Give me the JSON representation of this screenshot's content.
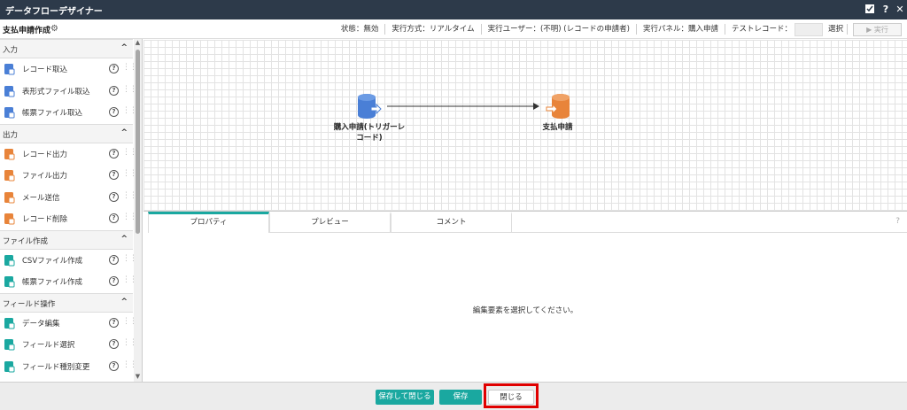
{
  "window": {
    "title": "データフローデザイナー",
    "controls": [
      "minimize-icon",
      "help-icon",
      "close-icon"
    ]
  },
  "header": {
    "flow_name": "支払申請作成",
    "status": "状態：無効",
    "exec_mode": "実行方式：リアルタイム",
    "exec_user": "実行ユーザー：(不明) (レコードの申請者)",
    "exec_panel": "実行パネル：購入申請",
    "test_record_label": "テストレコード：",
    "select_label": "選択",
    "run_label": "▶ 実行"
  },
  "sidebar": {
    "sections": [
      {
        "title": "入力",
        "items": [
          {
            "label": "レコード取込",
            "icon": "record-import-icon",
            "color": "#4a7fd6"
          },
          {
            "label": "表形式ファイル取込",
            "icon": "table-file-import-icon",
            "color": "#4a7fd6"
          },
          {
            "label": "帳票ファイル取込",
            "icon": "form-file-import-icon",
            "color": "#4a7fd6"
          }
        ]
      },
      {
        "title": "出力",
        "items": [
          {
            "label": "レコード出力",
            "icon": "record-output-icon",
            "color": "#e8843a"
          },
          {
            "label": "ファイル出力",
            "icon": "file-output-icon",
            "color": "#e8843a"
          },
          {
            "label": "メール送信",
            "icon": "mail-send-icon",
            "color": "#e8843a"
          },
          {
            "label": "レコード削除",
            "icon": "record-delete-icon",
            "color": "#e8843a"
          }
        ]
      },
      {
        "title": "ファイル作成",
        "items": [
          {
            "label": "CSVファイル作成",
            "icon": "csv-file-icon",
            "color": "#1aa8a0"
          },
          {
            "label": "帳票ファイル作成",
            "icon": "form-file-create-icon",
            "color": "#1aa8a0"
          }
        ]
      },
      {
        "title": "フィールド操作",
        "items": [
          {
            "label": "データ編集",
            "icon": "data-edit-icon",
            "color": "#1aa8a0"
          },
          {
            "label": "フィールド選択",
            "icon": "field-select-icon",
            "color": "#1aa8a0"
          },
          {
            "label": "フィールド種別変更",
            "icon": "field-type-change-icon",
            "color": "#1aa8a0"
          }
        ]
      }
    ]
  },
  "canvas": {
    "nodes": [
      {
        "label": "購入申請(トリガーレコード)",
        "label_line1": "購入申請(トリガーレ",
        "label_line2": "コード)",
        "color": "#4a7fd6",
        "icon": "database-input-icon"
      },
      {
        "label": "支払申請",
        "color": "#e8843a",
        "icon": "database-output-icon"
      }
    ]
  },
  "panel": {
    "tabs": [
      "プロパティ",
      "プレビュー",
      "コメント"
    ],
    "active_tab": "プロパティ",
    "help": "?",
    "message": "編集要素を選択してください。"
  },
  "footer": {
    "save_close_label": "保存して閉じる",
    "save_label": "保存",
    "close_label": "閉じる",
    "accent_color": "#1aa8a0",
    "highlight_color": "#e00000"
  }
}
